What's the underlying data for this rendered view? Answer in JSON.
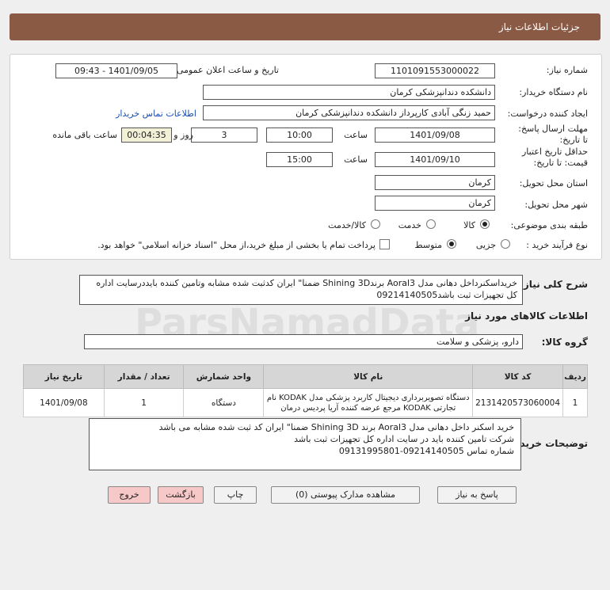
{
  "page_title": "جزئیات اطلاعات نیاز",
  "need_number": {
    "label": "شماره نیاز:",
    "value": "1101091553000022"
  },
  "announce": {
    "label": "تاریخ و ساعت اعلان عمومی:",
    "value": "1401/09/05 - 09:43"
  },
  "buyer_org": {
    "label": "نام دستگاه خریدار:",
    "value": "دانشکده دندانپزشکی کرمان"
  },
  "requester": {
    "label": "ایجاد کننده درخواست:",
    "value": "حمید زنگی آبادی کارپرداز دانشکده دندانپزشکی کرمان",
    "contact_link": "اطلاعات تماس خریدار"
  },
  "deadline": {
    "label": "مهلت ارسال پاسخ: تا تاریخ:",
    "date": "1401/09/08",
    "time_label": "ساعت",
    "time": "10:00",
    "days": "3",
    "days_label": "روز و",
    "remaining": "00:04:35",
    "remaining_label": "ساعت باقی مانده"
  },
  "validity": {
    "label": "حداقل تاریخ اعتبار قیمت: تا تاریخ:",
    "date": "1401/09/10",
    "time_label": "ساعت",
    "time": "15:00"
  },
  "province": {
    "label": "استان محل تحویل:",
    "value": "کرمان"
  },
  "city": {
    "label": "شهر محل تحویل:",
    "value": "کرمان"
  },
  "category": {
    "label": "طبقه بندی موضوعی:",
    "options": [
      "کالا",
      "خدمت",
      "کالا/خدمت"
    ],
    "selected": "کالا"
  },
  "process": {
    "label": "نوع فرآیند خرید :",
    "options": [
      "جزیی",
      "متوسط"
    ],
    "selected": "متوسط",
    "payment_note": "پرداخت تمام یا بخشی از مبلغ خرید،از محل \"اسناد خزانه اسلامی\" خواهد بود."
  },
  "summary": {
    "label": "شرح کلی نیاز:",
    "text": "خریداسکنرداخل دهانی مدل Aoral3 برندShining 3D ضمنا\" ایران کدثبت شده مشابه وتامین کننده بایددرسایت اداره کل تجهیزات ثبت باشد09214140505"
  },
  "goods_info_title": "اطلاعات کالاهای مورد نیاز",
  "goods_group": {
    "label": "گروه کالا:",
    "value": "دارو، پزشکی و سلامت"
  },
  "table": {
    "headers": [
      "ردیف",
      "کد کالا",
      "نام کالا",
      "واحد شمارش",
      "تعداد / مقدار",
      "تاریخ نیاز"
    ],
    "rows": [
      {
        "row": "1",
        "code": "2131420573060004",
        "name": "دستگاه تصویربرداری دیجیتال کاربرد پزشکی مدل KODAK نام تجارتی KODAK مرجع عرضه کننده آریا پردیس درمان",
        "unit": "دستگاه",
        "qty": "1",
        "date": "1401/09/08"
      }
    ]
  },
  "buyer_notes": {
    "label": "توضیحات خریدار:",
    "lines": [
      "خرید اسکنر داخل دهانی مدل Aoral3 برند Shining 3D ضمنا\" ایران کد ثبت شده مشابه می باشد",
      "شرکت تامین کننده باید در سایت اداره کل تجهیزات ثبت باشد",
      "شماره تماس 09214140505-09131995801"
    ]
  },
  "buttons": {
    "reply": "پاسخ به نیاز",
    "attachments": "مشاهده مدارک پیوستی (0)",
    "print": "چاپ",
    "back": "بازگشت",
    "exit": "خروج"
  },
  "watermark": "ParsNamadData"
}
